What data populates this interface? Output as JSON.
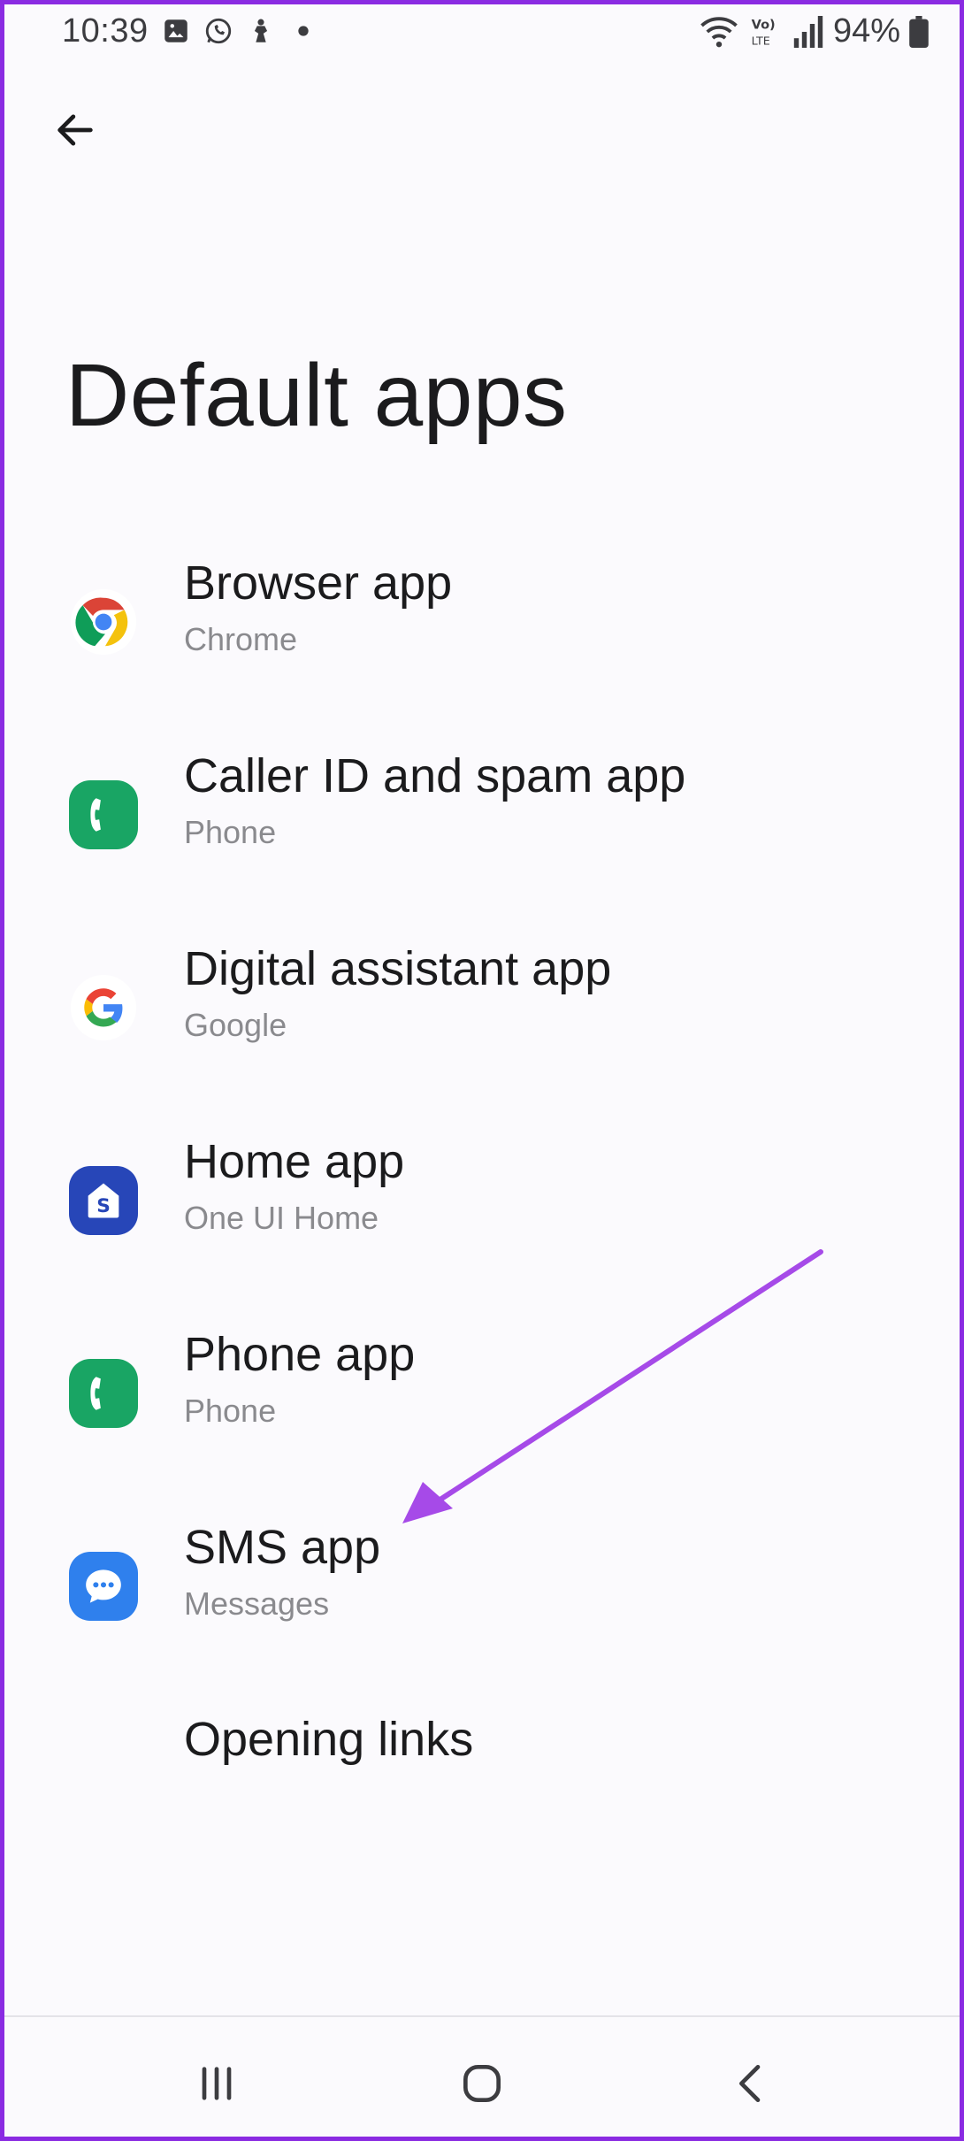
{
  "status_bar": {
    "time": "10:39",
    "battery_percent": "94%",
    "left_icons": [
      "gallery-icon",
      "whatsapp-icon",
      "person-icon",
      "dot-icon"
    ],
    "right_icons": [
      "wifi-icon",
      "volte-icon",
      "signal-icon",
      "battery-icon"
    ]
  },
  "header": {
    "back_icon": "back-arrow-icon",
    "title": "Default apps"
  },
  "items": [
    {
      "title": "Browser app",
      "subtitle": "Chrome",
      "icon": "chrome-icon"
    },
    {
      "title": "Caller ID and spam app",
      "subtitle": "Phone",
      "icon": "phone-app-icon"
    },
    {
      "title": "Digital assistant app",
      "subtitle": "Google",
      "icon": "google-icon"
    },
    {
      "title": "Home app",
      "subtitle": "One UI Home",
      "icon": "one-ui-home-icon"
    },
    {
      "title": "Phone app",
      "subtitle": "Phone",
      "icon": "phone-app-icon"
    },
    {
      "title": "SMS app",
      "subtitle": "Messages",
      "icon": "messages-icon"
    }
  ],
  "opening_links": {
    "title": "Opening links"
  },
  "nav_bar": {
    "icons": [
      "recents-icon",
      "home-icon",
      "back-icon"
    ]
  },
  "colors": {
    "accent_frame": "#8a2be2",
    "annotation_arrow": "#a64ae8",
    "phone_green": "#19a564",
    "home_blue": "#2746b8",
    "messages_blue": "#2f80ed"
  }
}
